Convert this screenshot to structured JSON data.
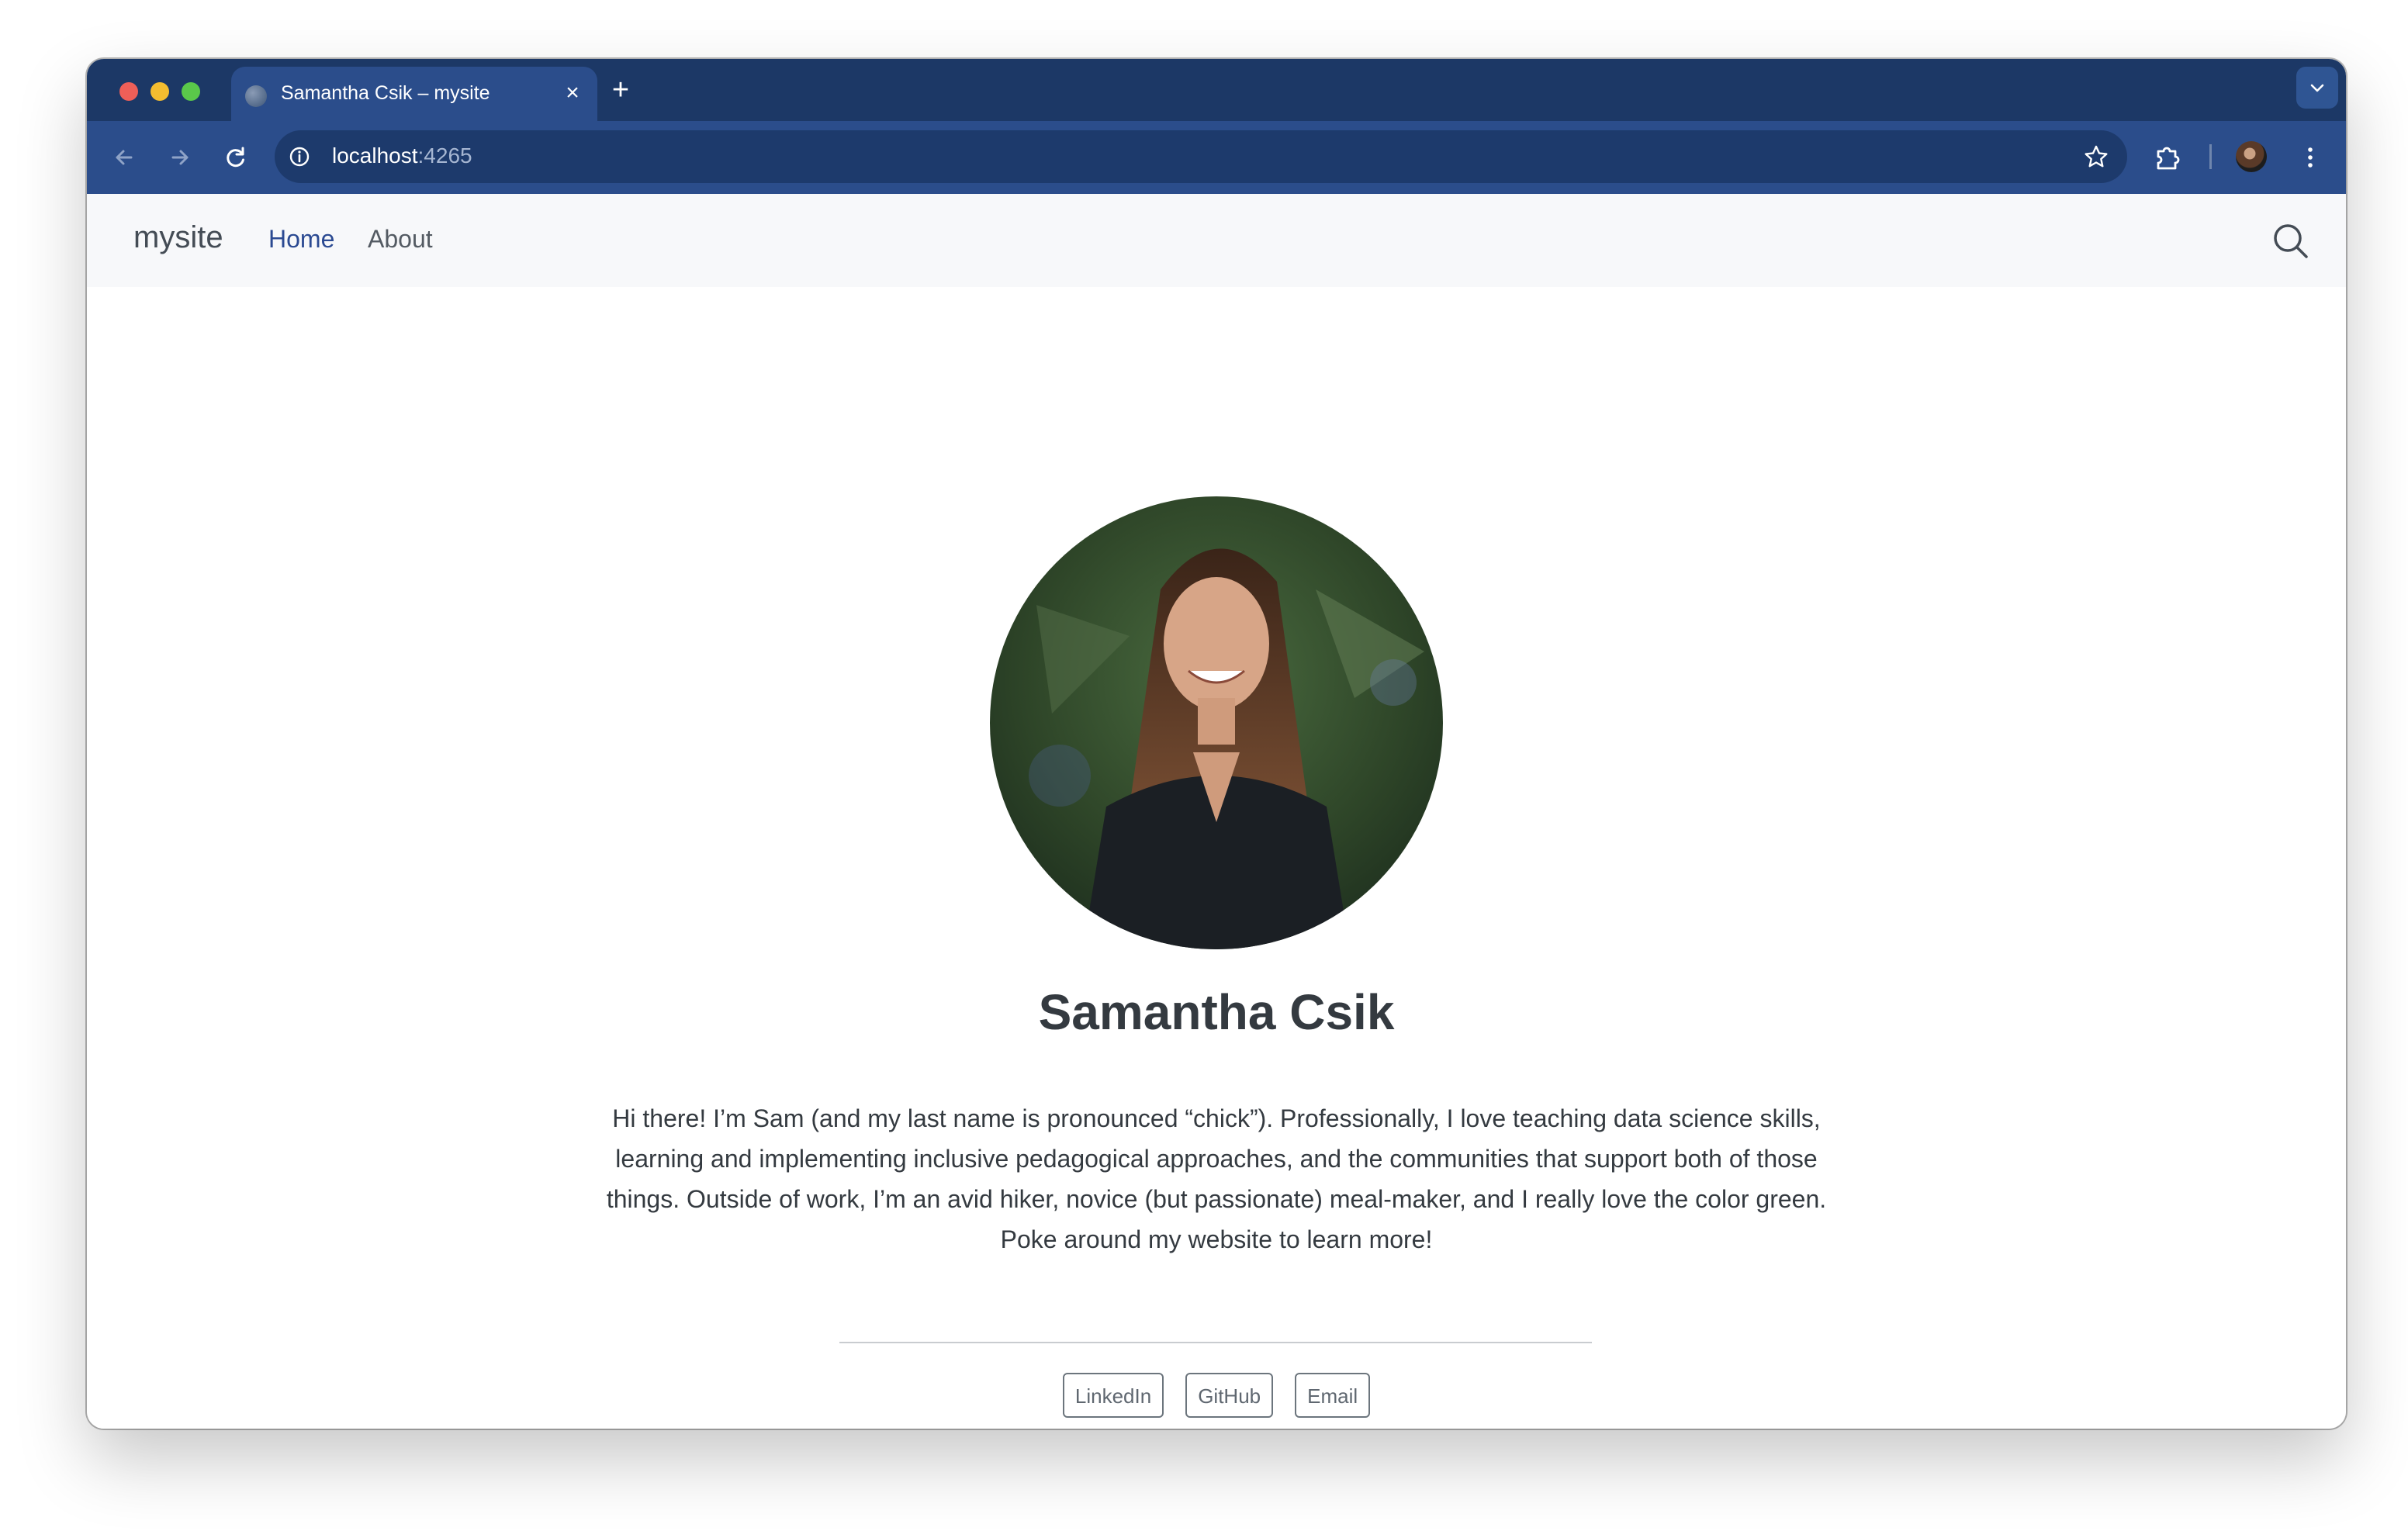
{
  "browser": {
    "tab_title": "Samantha Csik – mysite",
    "tab_close": "×",
    "new_tab": "+",
    "url_host": "localhost",
    "url_port": ":4265"
  },
  "navbar": {
    "brand": "mysite",
    "links": [
      {
        "label": "Home",
        "active": true
      },
      {
        "label": "About",
        "active": false
      }
    ]
  },
  "profile": {
    "name": "Samantha Csik",
    "bio": "Hi there! I’m Sam (and my last name is pronounced “chick”). Professionally, I love teaching data science skills, learning and implementing inclusive pedagogical approaches, and the communities that support both of those things. Outside of work, I’m an avid hiker, novice (but passionate) meal-maker, and I really love the color green. Poke around my website to learn more!"
  },
  "links": [
    {
      "label": "LinkedIn"
    },
    {
      "label": "GitHub"
    },
    {
      "label": "Email"
    }
  ],
  "colors": {
    "tab_strip": "#1c3866",
    "toolbar": "#2b4d8b",
    "nav_active": "#2b4a92",
    "heading": "#343a40"
  }
}
